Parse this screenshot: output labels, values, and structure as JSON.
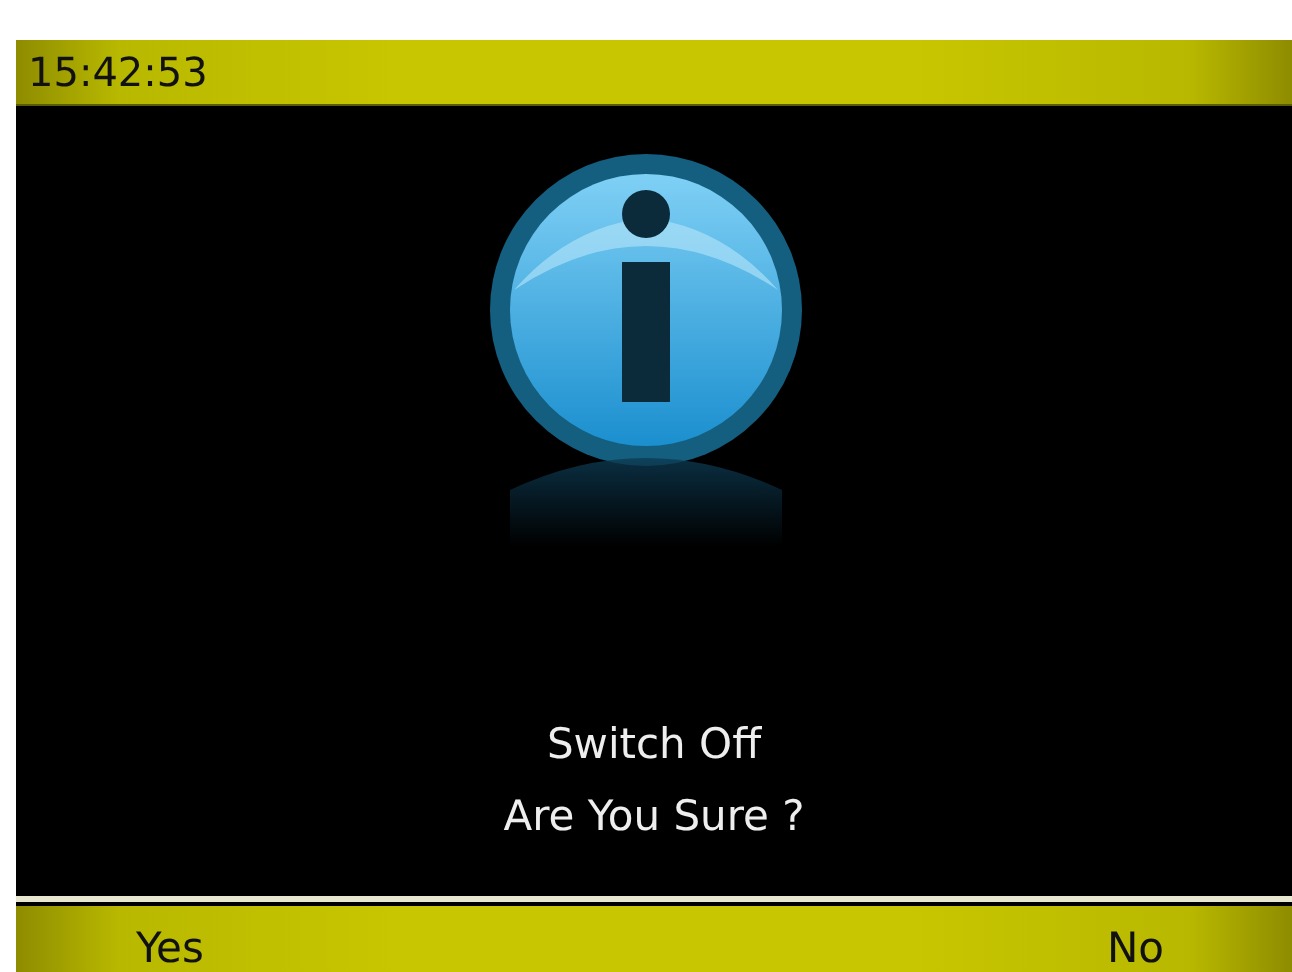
{
  "status_bar": {
    "time": "15:42:53"
  },
  "dialog": {
    "kind": "info",
    "lines": [
      "Switch Off",
      "Are You Sure ?"
    ]
  },
  "softkeys": {
    "left": "Yes",
    "right": "No"
  }
}
